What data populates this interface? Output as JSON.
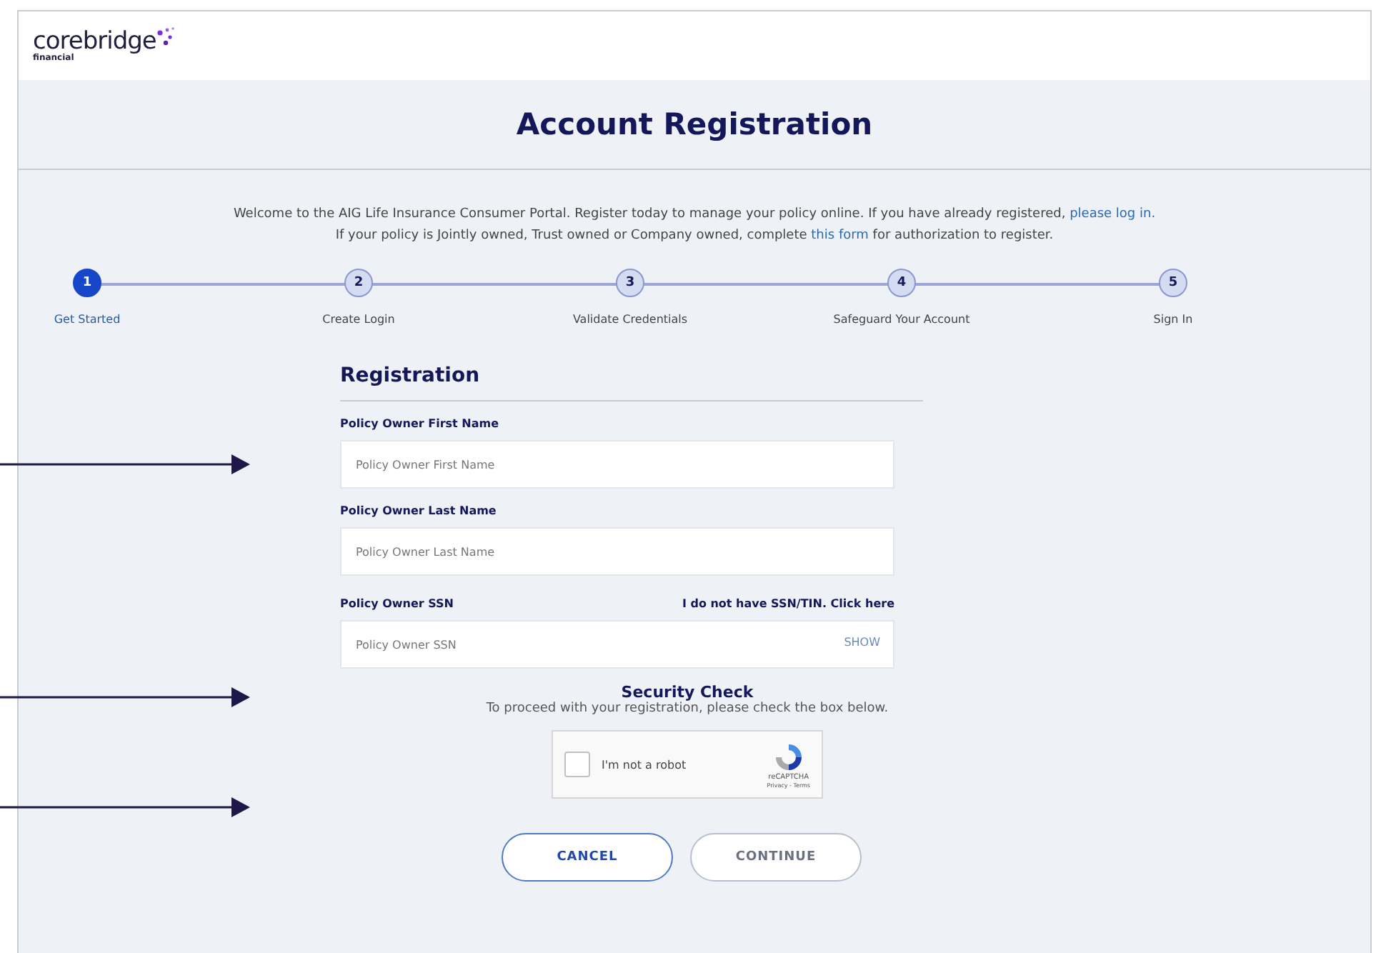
{
  "logo": {
    "name": "corebridge",
    "sub": "financial"
  },
  "title": "Account Registration",
  "intro": {
    "line1": "Welcome to the AIG Life Insurance Consumer Portal. Register today to manage your policy online. If you have already registered, ",
    "link1": "please log in.",
    "line2a": "If your policy is Jointly owned, Trust owned or Company owned, complete ",
    "link2": "this form",
    "line2b": " for authorization to register."
  },
  "steps": [
    {
      "number": "1",
      "label": "Get Started",
      "selected": true
    },
    {
      "number": "2",
      "label": "Create Login",
      "selected": false
    },
    {
      "number": "3",
      "label": "Validate Credentials",
      "selected": false
    },
    {
      "number": "4",
      "label": "Safeguard Your Account",
      "selected": false
    },
    {
      "number": "5",
      "label": "Sign In",
      "selected": false
    }
  ],
  "form": {
    "heading": "Registration",
    "fields": [
      {
        "label": "Policy Owner First Name",
        "placeholder": "Policy Owner First Name"
      },
      {
        "label": "Policy Owner Last Name",
        "placeholder": "Policy Owner Last Name"
      },
      {
        "label": "Policy Owner SSN",
        "placeholder": "Policy Owner SSN",
        "side_link": "I do not have SSN/TIN. Click here",
        "toggle": "SHOW"
      }
    ]
  },
  "security": {
    "title": "Security Check",
    "text": "To proceed with your registration, please check the box below.",
    "captcha": {
      "label": "I'm not a robot",
      "checked": false,
      "brand": "reCAPTCHA",
      "links": "Privacy - Terms"
    }
  },
  "buttons": [
    {
      "label": "CANCEL",
      "kind": "primary"
    },
    {
      "label": "CONTINUE",
      "kind": "secondary"
    }
  ]
}
